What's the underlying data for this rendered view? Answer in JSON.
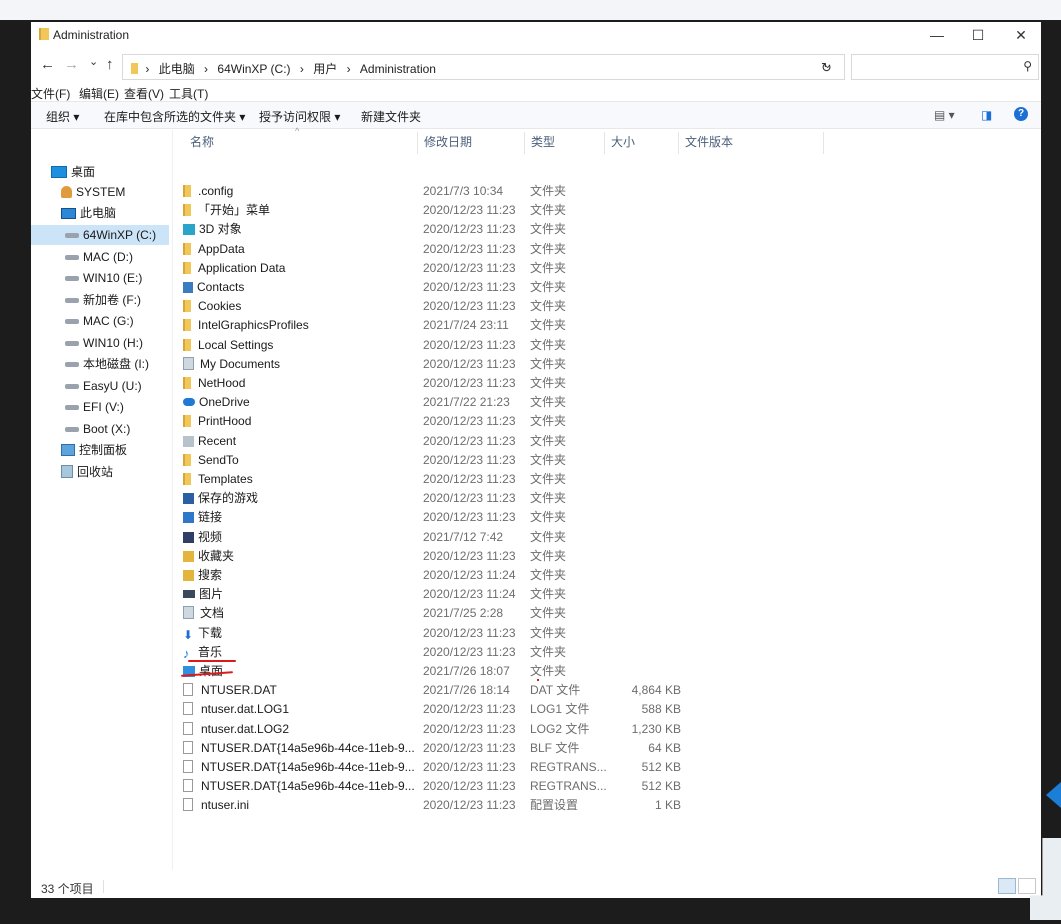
{
  "window": {
    "title": "Administration",
    "controls": {
      "minimize": "—",
      "maximize": "☐",
      "close": "✕"
    }
  },
  "address": {
    "back": "←",
    "forward": "→",
    "recent": "⌄",
    "up": "↑",
    "crumbs": [
      "此电脑",
      "64WinXP (C:)",
      "用户",
      "Administration"
    ],
    "separator": "›",
    "dropdown": "⌄",
    "refresh": "↻",
    "search_icon": "⚲"
  },
  "menu": [
    "文件(F)",
    "编辑(E)",
    "查看(V)",
    "工具(T)"
  ],
  "toolbar": {
    "organize": "组织 ▾",
    "include_library": "在库中包含所选的文件夹 ▾",
    "share": "授予访问权限 ▾",
    "new_folder": "新建文件夹",
    "view_icon": "▤ ▾",
    "pane_icon": "◨",
    "help": "?"
  },
  "nav": [
    {
      "label": "桌面",
      "icon": "desktop-icon"
    },
    {
      "label": "SYSTEM",
      "icon": "user-icon"
    },
    {
      "label": "此电脑",
      "icon": "pc-icon"
    },
    {
      "label": "64WinXP  (C:)",
      "icon": "drive-icon",
      "selected": true
    },
    {
      "label": "MAC (D:)",
      "icon": "drive-icon"
    },
    {
      "label": "WIN10 (E:)",
      "icon": "drive-icon"
    },
    {
      "label": "新加卷 (F:)",
      "icon": "drive-icon"
    },
    {
      "label": "MAC (G:)",
      "icon": "drive-icon"
    },
    {
      "label": "WIN10 (H:)",
      "icon": "drive-icon"
    },
    {
      "label": "本地磁盘 (I:)",
      "icon": "drive-icon"
    },
    {
      "label": "EasyU (U:)",
      "icon": "drive-icon"
    },
    {
      "label": "EFI (V:)",
      "icon": "drive-icon"
    },
    {
      "label": "Boot (X:)",
      "icon": "drive-icon"
    },
    {
      "label": "控制面板",
      "icon": "control-panel-icon"
    },
    {
      "label": "回收站",
      "icon": "recycle-bin-icon"
    }
  ],
  "columns": {
    "name": "名称",
    "date": "修改日期",
    "type": "类型",
    "size": "大小",
    "version": "文件版本"
  },
  "files": [
    {
      "name": ".config",
      "date": "2021/7/3 10:34",
      "type": "文件夹",
      "size": "",
      "icon": "folder"
    },
    {
      "name": "「开始」菜单",
      "date": "2020/12/23 11:23",
      "type": "文件夹",
      "size": "",
      "icon": "folder"
    },
    {
      "name": "3D 对象",
      "date": "2020/12/23 11:23",
      "type": "文件夹",
      "size": "",
      "icon": "3d"
    },
    {
      "name": "AppData",
      "date": "2020/12/23 11:23",
      "type": "文件夹",
      "size": "",
      "icon": "folder"
    },
    {
      "name": "Application Data",
      "date": "2020/12/23 11:23",
      "type": "文件夹",
      "size": "",
      "icon": "folder"
    },
    {
      "name": "Contacts",
      "date": "2020/12/23 11:23",
      "type": "文件夹",
      "size": "",
      "icon": "contacts"
    },
    {
      "name": "Cookies",
      "date": "2020/12/23 11:23",
      "type": "文件夹",
      "size": "",
      "icon": "folder"
    },
    {
      "name": "IntelGraphicsProfiles",
      "date": "2021/7/24 23:11",
      "type": "文件夹",
      "size": "",
      "icon": "folder"
    },
    {
      "name": "Local Settings",
      "date": "2020/12/23 11:23",
      "type": "文件夹",
      "size": "",
      "icon": "folder"
    },
    {
      "name": "My Documents",
      "date": "2020/12/23 11:23",
      "type": "文件夹",
      "size": "",
      "icon": "doc"
    },
    {
      "name": "NetHood",
      "date": "2020/12/23 11:23",
      "type": "文件夹",
      "size": "",
      "icon": "folder"
    },
    {
      "name": "OneDrive",
      "date": "2021/7/22 21:23",
      "type": "文件夹",
      "size": "",
      "icon": "onedrive"
    },
    {
      "name": "PrintHood",
      "date": "2020/12/23 11:23",
      "type": "文件夹",
      "size": "",
      "icon": "folder"
    },
    {
      "name": "Recent",
      "date": "2020/12/23 11:23",
      "type": "文件夹",
      "size": "",
      "icon": "gray"
    },
    {
      "name": "SendTo",
      "date": "2020/12/23 11:23",
      "type": "文件夹",
      "size": "",
      "icon": "folder"
    },
    {
      "name": "Templates",
      "date": "2020/12/23 11:23",
      "type": "文件夹",
      "size": "",
      "icon": "folder"
    },
    {
      "name": "保存的游戏",
      "date": "2020/12/23 11:23",
      "type": "文件夹",
      "size": "",
      "icon": "game"
    },
    {
      "name": "链接",
      "date": "2020/12/23 11:23",
      "type": "文件夹",
      "size": "",
      "icon": "link"
    },
    {
      "name": "视频",
      "date": "2021/7/12 7:42",
      "type": "文件夹",
      "size": "",
      "icon": "video"
    },
    {
      "name": "收藏夹",
      "date": "2020/12/23 11:23",
      "type": "文件夹",
      "size": "",
      "icon": "gold"
    },
    {
      "name": "搜索",
      "date": "2020/12/23 11:24",
      "type": "文件夹",
      "size": "",
      "icon": "gold"
    },
    {
      "name": "图片",
      "date": "2020/12/23 11:24",
      "type": "文件夹",
      "size": "",
      "icon": "pic"
    },
    {
      "name": "文档",
      "date": "2021/7/25 2:28",
      "type": "文件夹",
      "size": "",
      "icon": "doc"
    },
    {
      "name": "下载",
      "date": "2020/12/23 11:23",
      "type": "文件夹",
      "size": "",
      "icon": "down"
    },
    {
      "name": "音乐",
      "date": "2020/12/23 11:23",
      "type": "文件夹",
      "size": "",
      "icon": "music"
    },
    {
      "name": "桌面",
      "date": "2021/7/26 18:07",
      "type": "文件夹",
      "size": "",
      "icon": "special"
    },
    {
      "name": "NTUSER.DAT",
      "date": "2021/7/26 18:14",
      "type": "DAT 文件",
      "size": "4,864 KB",
      "icon": "file"
    },
    {
      "name": "ntuser.dat.LOG1",
      "date": "2020/12/23 11:23",
      "type": "LOG1 文件",
      "size": "588 KB",
      "icon": "file"
    },
    {
      "name": "ntuser.dat.LOG2",
      "date": "2020/12/23 11:23",
      "type": "LOG2 文件",
      "size": "1,230 KB",
      "icon": "file"
    },
    {
      "name": "NTUSER.DAT{14a5e96b-44ce-11eb-9...",
      "date": "2020/12/23 11:23",
      "type": "BLF 文件",
      "size": "64 KB",
      "icon": "file"
    },
    {
      "name": "NTUSER.DAT{14a5e96b-44ce-11eb-9...",
      "date": "2020/12/23 11:23",
      "type": "REGTRANS...",
      "size": "512 KB",
      "icon": "file"
    },
    {
      "name": "NTUSER.DAT{14a5e96b-44ce-11eb-9...",
      "date": "2020/12/23 11:23",
      "type": "REGTRANS...",
      "size": "512 KB",
      "icon": "file"
    },
    {
      "name": "ntuser.ini",
      "date": "2020/12/23 11:23",
      "type": "配置设置",
      "size": "1 KB",
      "icon": "file"
    }
  ],
  "status": {
    "count": "33 个项目"
  }
}
